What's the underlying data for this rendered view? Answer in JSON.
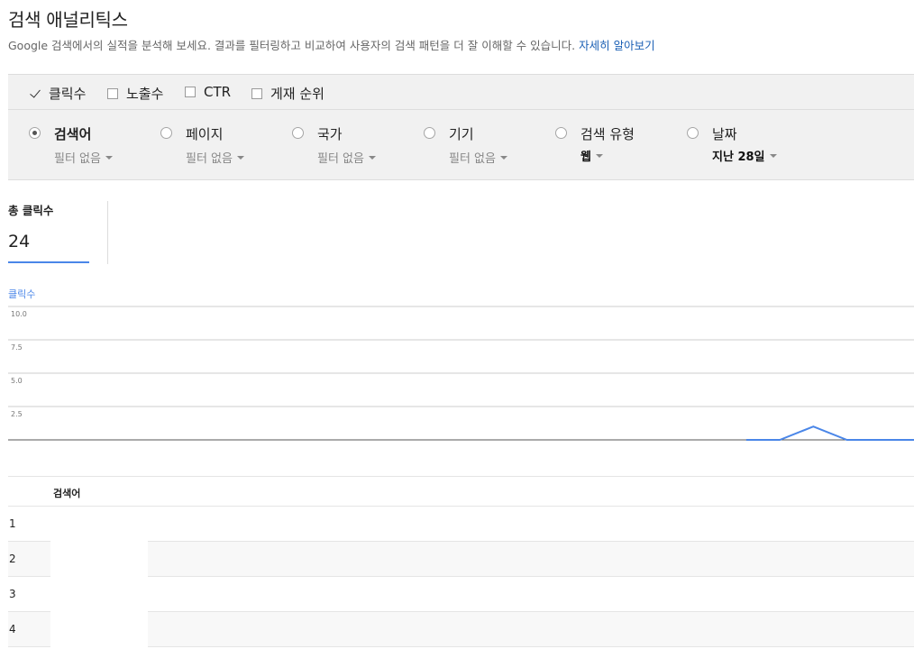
{
  "header": {
    "title": "검색 애널리틱스",
    "description": "Google 검색에서의 실적을 분석해 보세요. 결과를 필터링하고 비교하여 사용자의 검색 패턴을 더 잘 이해할 수 있습니다.",
    "learn_more": "자세히 알아보기"
  },
  "metrics": [
    {
      "label": "클릭수",
      "checked": true
    },
    {
      "label": "노출수",
      "checked": false
    },
    {
      "label": "CTR",
      "checked": false
    },
    {
      "label": "게재 순위",
      "checked": false
    }
  ],
  "dimensions": [
    {
      "label": "검색어",
      "filter": "필터 없음",
      "selected": true
    },
    {
      "label": "페이지",
      "filter": "필터 없음",
      "selected": false
    },
    {
      "label": "국가",
      "filter": "필터 없음",
      "selected": false
    },
    {
      "label": "기기",
      "filter": "필터 없음",
      "selected": false
    },
    {
      "label": "검색 유형",
      "filter": "웹",
      "selected": false
    },
    {
      "label": "날짜",
      "filter": "지난 28일",
      "selected": false
    }
  ],
  "summary": {
    "label": "총 클릭수",
    "value": "24"
  },
  "colors": {
    "accent": "#4a86e8",
    "link": "#1a5fb4",
    "bar_bg": "#f1f1f1"
  },
  "chart_data": {
    "type": "line",
    "series_label": "클릭수",
    "ylim": [
      0,
      10
    ],
    "yticks": [
      "10.0",
      "7.5",
      "5.0",
      "2.5"
    ],
    "grid": true,
    "series": [
      {
        "x": [
          22,
          23,
          24,
          25,
          26,
          27
        ],
        "values": [
          0,
          0,
          1,
          0,
          0,
          0
        ]
      }
    ],
    "x_count": 28
  },
  "table": {
    "column_header": "검색어",
    "rows": [
      "1",
      "2",
      "3",
      "4"
    ]
  }
}
